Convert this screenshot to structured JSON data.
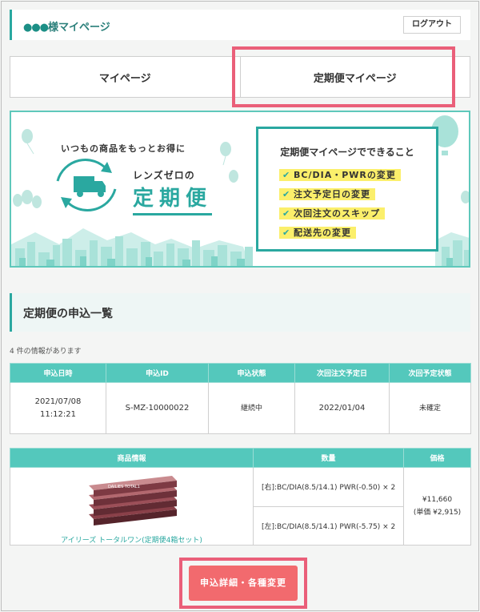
{
  "header": {
    "title_dots": "●●●",
    "title": "様マイページ",
    "logout_label": "ログアウト"
  },
  "tabs": [
    {
      "label": "マイページ"
    },
    {
      "label": "定期便マイページ"
    }
  ],
  "banner": {
    "catch": "いつもの商品をもっとお得に",
    "sub": "レンズゼロの",
    "main": "定期便",
    "box_title": "定期便マイページでできること",
    "items": [
      "BC/DIA・PWRの変更",
      "注文予定日の変更",
      "次回注文のスキップ",
      "配送先の変更"
    ]
  },
  "section": {
    "title": "定期便の申込一覧",
    "count": "4 件の情報があります"
  },
  "subscription_table": {
    "headers": [
      "申込日時",
      "申込ID",
      "申込状態",
      "次回注文予定日",
      "次回予定状態"
    ],
    "row": {
      "date": "2021/07/08",
      "time": "11:12:21",
      "id": "S-MZ-10000022",
      "status": "継続中",
      "next_date": "2022/01/04",
      "next_status": "未確定"
    }
  },
  "product_table": {
    "headers": [
      "商品情報",
      "数量",
      "価格"
    ],
    "product_name": "アイリーズ トータルワン(定期便4箱セット)",
    "box_text": "DAILIES TOTAL1",
    "qty_right": "[右]:BC/DIA(8.5/14.1) PWR(-0.50) × 2",
    "qty_left": "[左]:BC/DIA(8.5/14.1) PWR(-5.75) × 2",
    "price": "¥11,660",
    "unit_price": "(単価 ¥2,915)"
  },
  "submit_label": "申込詳細・各種変更",
  "colors": {
    "accent": "#2aa8a0",
    "table_header": "#54c8bc",
    "button": "#f26a6e",
    "highlight": "#ea5f79",
    "marker": "#fbef6b"
  }
}
